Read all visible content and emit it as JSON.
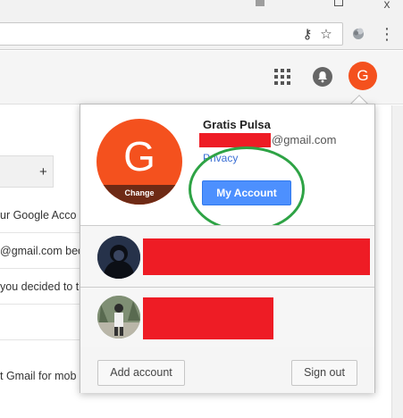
{
  "browser": {
    "minimize_glyph": "",
    "maximize_glyph": "",
    "close_glyph": "x",
    "key_icon_glyph": "⚷",
    "star_icon_glyph": "☆",
    "menu_glyph": "⋮"
  },
  "header": {
    "avatar_letter": "G",
    "accent_color": "#f4511e"
  },
  "background": {
    "tab_plus": "+",
    "lines": [
      "ur Google Acco",
      "@gmail.com bec",
      "you decided to t",
      "t Gmail for mob"
    ]
  },
  "popup": {
    "avatar_letter": "G",
    "change_label": "Change",
    "name": "Gratis Pulsa",
    "email_domain": "@gmail.com",
    "privacy_link": "Privacy",
    "my_account_label": "My Account",
    "add_account_label": "Add account",
    "sign_out_label": "Sign out",
    "other_accounts": [
      {
        "avatar": "dark-hooded-figure"
      },
      {
        "avatar": "person-outdoors"
      }
    ],
    "redaction_color": "#ee1c25",
    "highlight_ellipse_color": "#2ea345"
  }
}
